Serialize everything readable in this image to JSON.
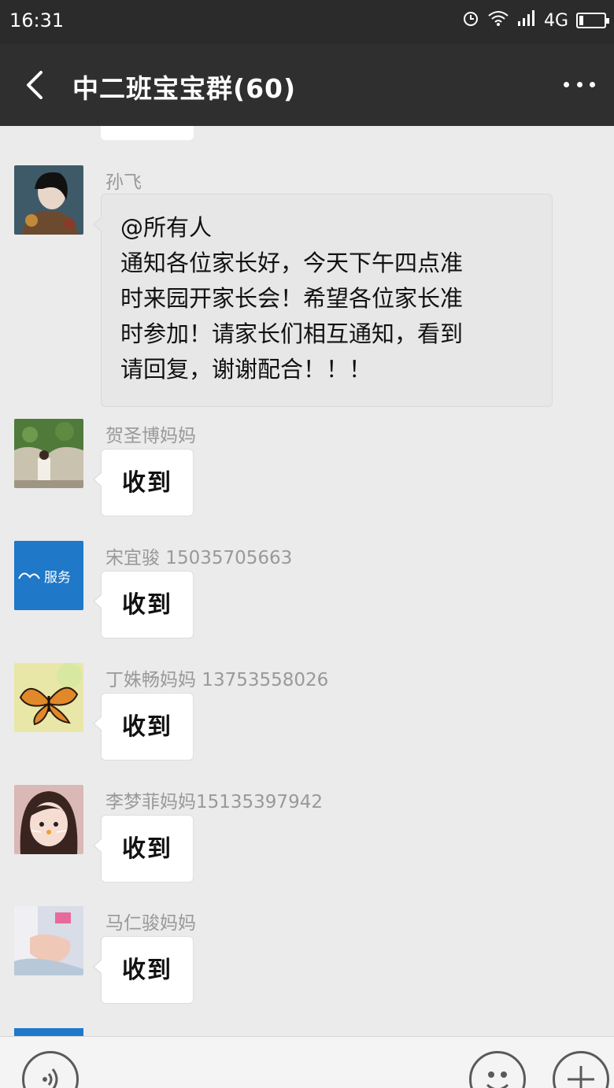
{
  "status_bar": {
    "time": "16:31",
    "network": "4G",
    "battery_level": 0.15
  },
  "header": {
    "back_label": "‹",
    "title": "中二班宝宝群(60)"
  },
  "messages": [
    {
      "sender": "孙飞",
      "text": "@所有人\n通知各位家长好，今天下午四点准\n时来园开家长会！希望各位家长准\n时参加！请家长们相互通知，看到\n请回复，谢谢配合！！！",
      "avatar": "woman-portrait-avatar"
    },
    {
      "sender": "贺圣博妈妈",
      "text": "收到",
      "avatar": "garden-photo-avatar"
    },
    {
      "sender": "宋宜骏  15035705663",
      "text": "收到",
      "avatar": "service-logo-avatar",
      "avatar_text": "服务"
    },
    {
      "sender": "丁姝畅妈妈  13753558026",
      "text": "收到",
      "avatar": "butterfly-avatar"
    },
    {
      "sender": "李梦菲妈妈15135397942",
      "text": "收到",
      "avatar": "girl-selfie-avatar"
    },
    {
      "sender": "马仁骏妈妈",
      "text": "收到",
      "avatar": "child-hand-avatar"
    }
  ],
  "input_bar": {
    "voice_icon": "voice-icon",
    "emoji_icon": "emoji-icon",
    "plus_icon": "plus-icon"
  },
  "colors": {
    "header_bg": "#2f2f2f",
    "chat_bg": "#ebebeb",
    "bubble_bg": "#ffffff",
    "sender_text": "#999999"
  }
}
